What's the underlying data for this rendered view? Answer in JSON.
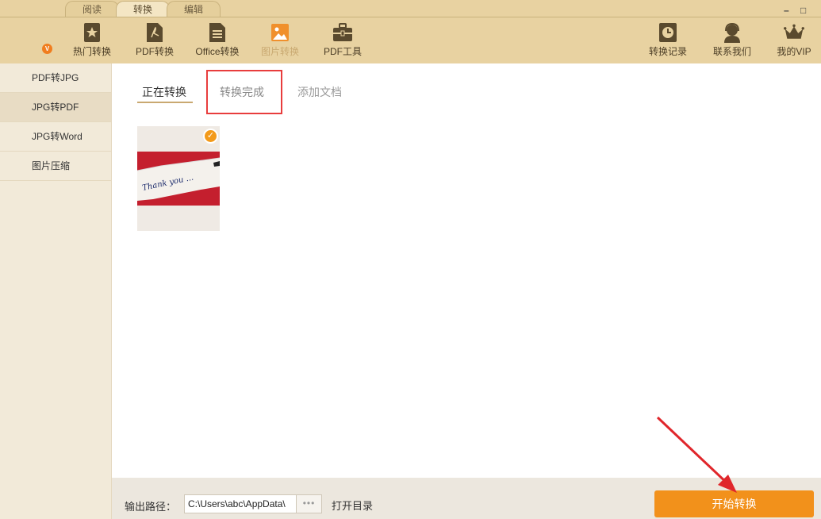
{
  "tabs": [
    "阅读",
    "转换",
    "编辑"
  ],
  "active_tab": "转换",
  "window_controls": {
    "minimize": "–",
    "maximize": "□"
  },
  "badge": "V",
  "toolbar": [
    {
      "label": "热门转换",
      "icon": "star-doc-icon"
    },
    {
      "label": "PDF转换",
      "icon": "pdf-doc-icon"
    },
    {
      "label": "Office转换",
      "icon": "office-doc-icon"
    },
    {
      "label": "图片转换",
      "icon": "image-icon",
      "active": true
    },
    {
      "label": "PDF工具",
      "icon": "toolbox-icon"
    }
  ],
  "right_tools": [
    {
      "label": "转换记录",
      "icon": "clock-icon"
    },
    {
      "label": "联系我们",
      "icon": "headset-icon"
    },
    {
      "label": "我的VIP",
      "icon": "crown-icon"
    }
  ],
  "sidebar": [
    "PDF转JPG",
    "JPG转PDF",
    "JPG转Word",
    "图片压缩"
  ],
  "sidebar_active": "JPG转PDF",
  "subtabs": [
    "正在转换",
    "转换完成",
    "添加文档"
  ],
  "file": {
    "image_text": "Thank you ...",
    "checked": true
  },
  "bottom": {
    "output_label": "输出路径：",
    "path": "C:\\Users\\abc\\AppData\\",
    "browse": "•••",
    "open_dir": "打开目录",
    "start": "开始转换"
  },
  "colors": {
    "header": "#e8d2a1",
    "accent": "#f2911b",
    "highlight_box": "#e83d3d",
    "arrow": "#e0262b"
  }
}
